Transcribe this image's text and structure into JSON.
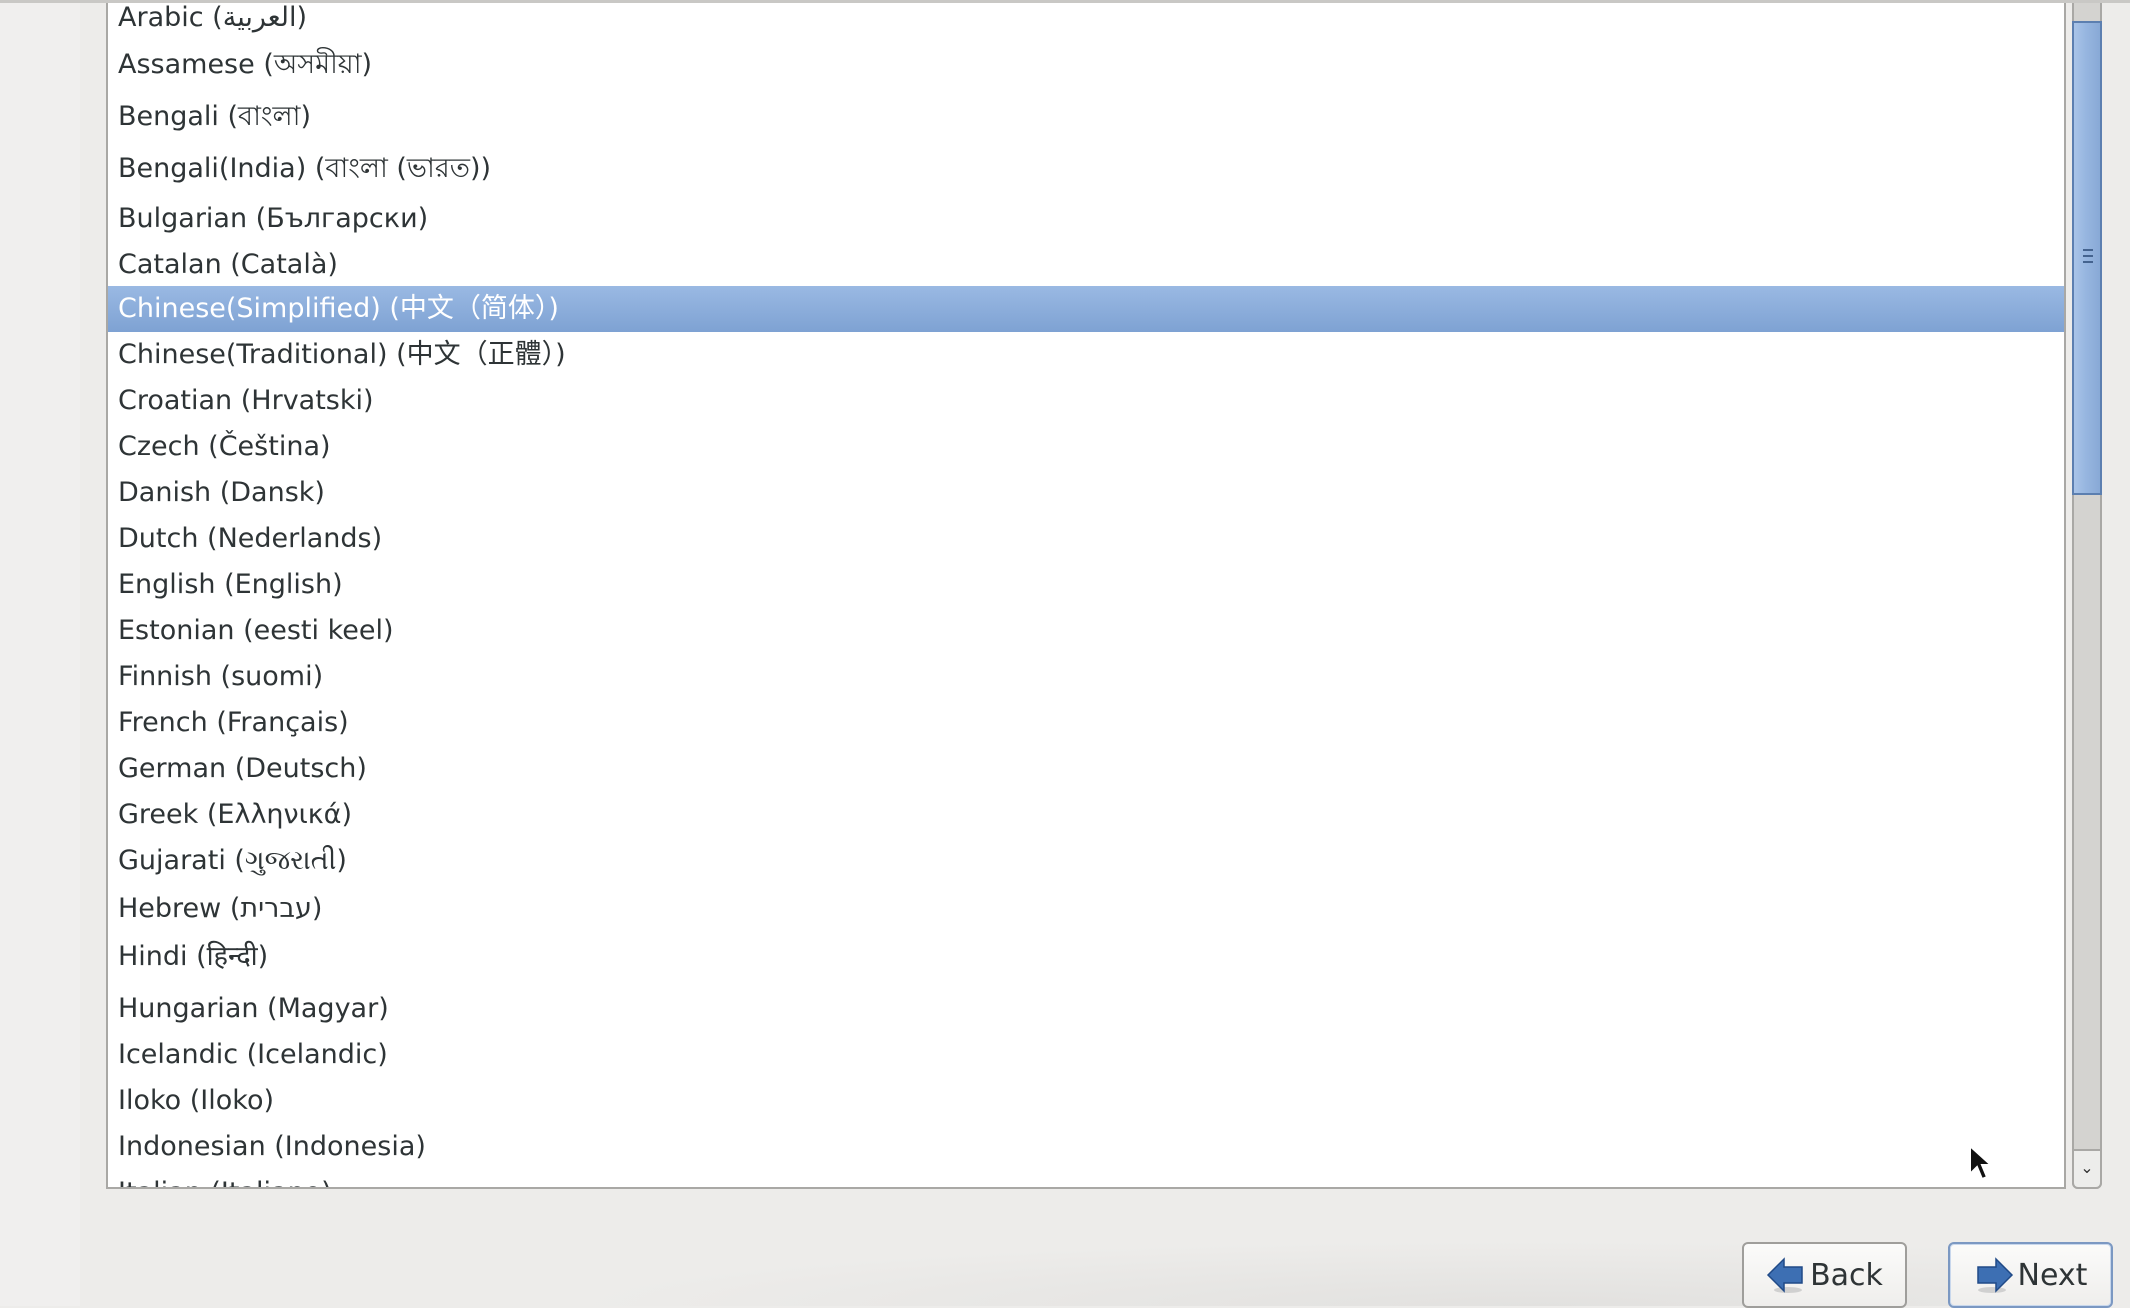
{
  "language_list": {
    "selected_index": 6,
    "items": [
      {
        "label": "Arabic (العربية)"
      },
      {
        "label": "Assamese (অসমীয়া)"
      },
      {
        "label": "Bengali (বাংলা)"
      },
      {
        "label": "Bengali(India) (বাংলা (ভারত))"
      },
      {
        "label": "Bulgarian (Български)"
      },
      {
        "label": "Catalan (Català)"
      },
      {
        "label": "Chinese(Simplified) (中文（简体）)"
      },
      {
        "label": "Chinese(Traditional) (中文（正體）)"
      },
      {
        "label": "Croatian (Hrvatski)"
      },
      {
        "label": "Czech (Čeština)"
      },
      {
        "label": "Danish (Dansk)"
      },
      {
        "label": "Dutch (Nederlands)"
      },
      {
        "label": "English (English)"
      },
      {
        "label": "Estonian (eesti keel)"
      },
      {
        "label": "Finnish (suomi)"
      },
      {
        "label": "French (Français)"
      },
      {
        "label": "German (Deutsch)"
      },
      {
        "label": "Greek (Ελληνικά)"
      },
      {
        "label": "Gujarati (ગુજરાતી)"
      },
      {
        "label": "Hebrew (עברית)"
      },
      {
        "label": "Hindi (हिन्दी)"
      },
      {
        "label": "Hungarian (Magyar)"
      },
      {
        "label": "Icelandic (Icelandic)"
      },
      {
        "label": "Iloko (Iloko)"
      },
      {
        "label": "Indonesian (Indonesia)"
      },
      {
        "label": "Italian (Italiano)"
      }
    ]
  },
  "scrollbar": {
    "down_arrow_icon": "chevron-down",
    "thumb_fraction_visible": 0.4,
    "scroll_position_fraction": 0.0
  },
  "buttons": {
    "back_label": "Back",
    "next_label": "Next",
    "back_icon": "arrow-left",
    "next_icon": "arrow-right"
  },
  "colors": {
    "selection": "#86a8d8",
    "selection_text": "#ffffff",
    "accent_arrow": "#3465a4"
  }
}
